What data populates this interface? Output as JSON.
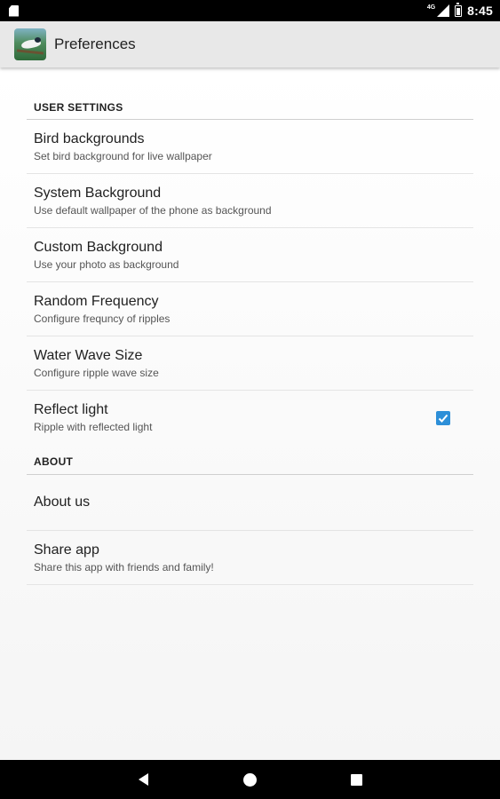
{
  "status_bar": {
    "time": "8:45",
    "network_type": "4G",
    "icons": [
      "sd-card-icon",
      "signal-icon",
      "battery-icon"
    ]
  },
  "app_bar": {
    "title": "Preferences",
    "icon": "app-bird-icon"
  },
  "sections": [
    {
      "header": "USER SETTINGS",
      "items": [
        {
          "title": "Bird backgrounds",
          "summary": "Set bird background for live wallpaper"
        },
        {
          "title": "System Background",
          "summary": "Use default wallpaper of the phone as background"
        },
        {
          "title": "Custom Background",
          "summary": "Use your photo as background"
        },
        {
          "title": "Random Frequency",
          "summary": "Configure frequncy of ripples"
        },
        {
          "title": "Water Wave Size",
          "summary": "Configure ripple wave size"
        },
        {
          "title": "Reflect light",
          "summary": "Ripple with reflected light",
          "checked": true
        }
      ]
    },
    {
      "header": "ABOUT",
      "items": [
        {
          "title": "About us"
        },
        {
          "title": "Share app",
          "summary": "Share this app with friends and family!"
        }
      ]
    }
  ],
  "colors": {
    "accent": "#2d8fd8",
    "app_bar": "#e8e8e8",
    "status_bar": "#000000"
  },
  "nav_bar": {
    "icons": [
      "back-icon",
      "home-icon",
      "recents-icon"
    ]
  }
}
